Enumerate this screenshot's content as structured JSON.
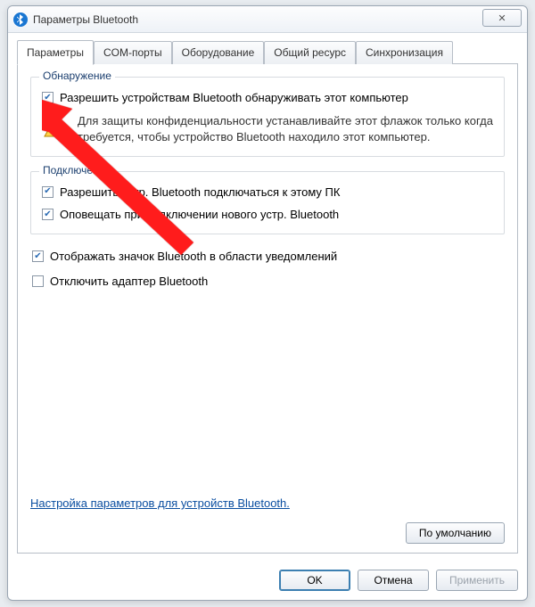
{
  "window": {
    "title": "Параметры Bluetooth",
    "close_glyph": "✕"
  },
  "tabs": [
    {
      "label": "Параметры"
    },
    {
      "label": "COM-порты"
    },
    {
      "label": "Оборудование"
    },
    {
      "label": "Общий ресурс"
    },
    {
      "label": "Синхронизация"
    }
  ],
  "discovery": {
    "title": "Обнаружение",
    "allow_discover": "Разрешить устройствам Bluetooth обнаруживать этот компьютер",
    "warning": "Для защиты конфиденциальности устанавливайте этот флажок только когда требуется, чтобы устройство Bluetooth находило этот компьютер."
  },
  "connections": {
    "title": "Подключения",
    "allow_connect": "Разрешить устр. Bluetooth подключаться к этому ПК",
    "notify": "Оповещать при подключении нового устр. Bluetooth"
  },
  "misc": {
    "show_tray": "Отображать значок Bluetooth в области уведомлений",
    "disable_adapter": "Отключить адаптер Bluetooth"
  },
  "link_text": "Настройка параметров для устройств Bluetooth.",
  "buttons": {
    "defaults": "По умолчанию",
    "ok": "OK",
    "cancel": "Отмена",
    "apply": "Применить"
  }
}
